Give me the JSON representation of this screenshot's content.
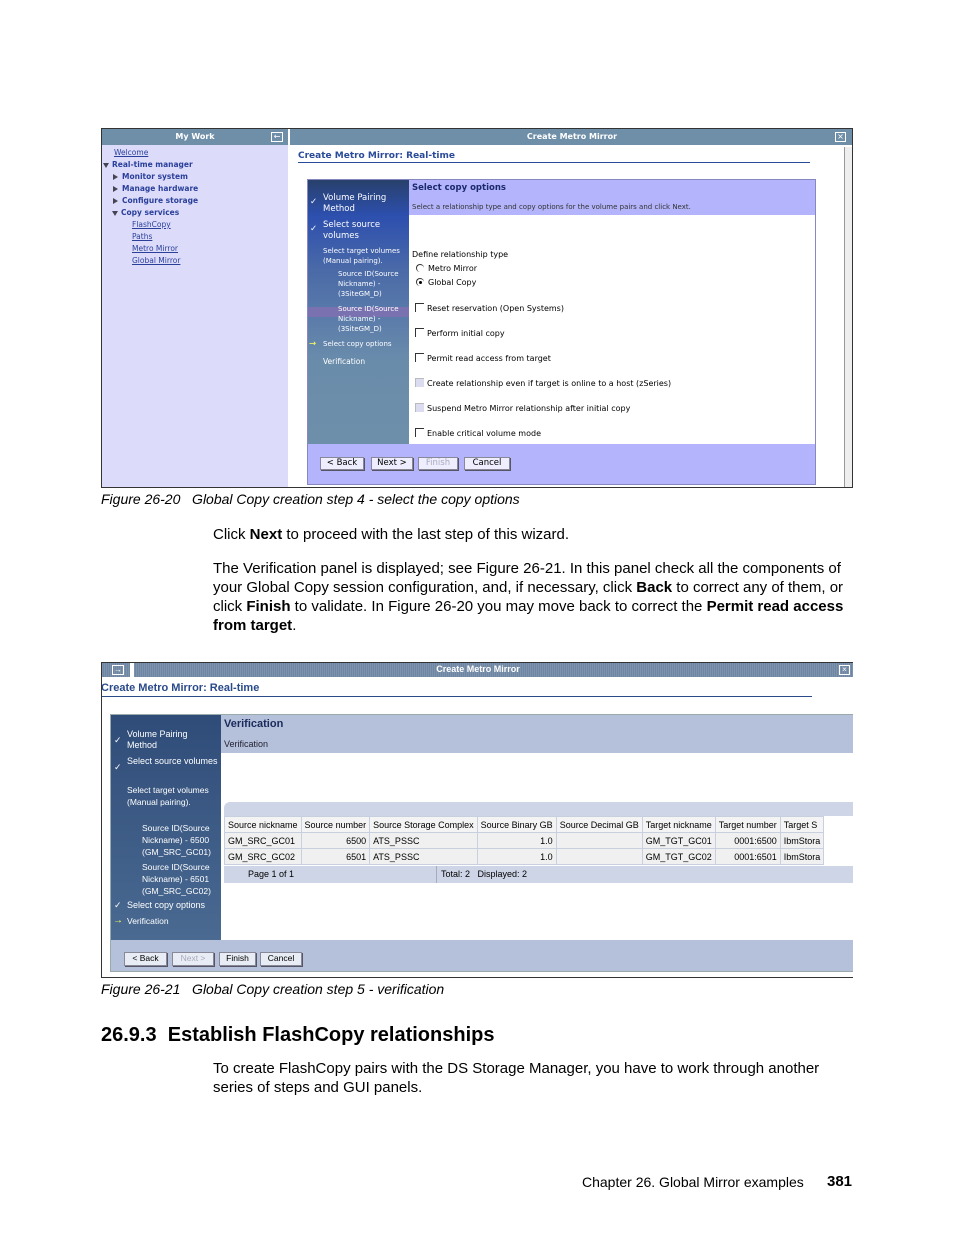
{
  "figure1": {
    "left_pane_title": "My Work",
    "nav": [
      {
        "label": "Welcome",
        "type": "link"
      },
      {
        "label": "Real-time manager",
        "type": "expanded"
      },
      {
        "label": "Monitor system",
        "type": "collapsed"
      },
      {
        "label": "Manage hardware",
        "type": "collapsed"
      },
      {
        "label": "Configure storage",
        "type": "collapsed"
      },
      {
        "label": "Copy services",
        "type": "expanded"
      },
      {
        "label": "FlashCopy",
        "type": "link"
      },
      {
        "label": "Paths",
        "type": "link"
      },
      {
        "label": "Metro Mirror",
        "type": "link"
      },
      {
        "label": "Global Mirror",
        "type": "link"
      }
    ],
    "window_title": "Create Metro Mirror",
    "page_title": "Create Metro Mirror: Real-time",
    "steps": [
      "Volume Pairing Method",
      "Select source volumes",
      "Select target volumes (Manual pairing).",
      "Source ID(Source Nickname) - (3SiteGM_D)",
      "Source ID(Source Nickname) - (3SiteGM_D)",
      "Select copy options",
      "Verification"
    ],
    "section_title": "Select copy options",
    "section_desc": "Select a relationship type and copy options for the volume pairs and click Next.",
    "relationship_label": "Define relationship type",
    "radios": [
      {
        "label": "Metro Mirror",
        "selected": false
      },
      {
        "label": "Global Copy",
        "selected": true
      }
    ],
    "checkboxes": [
      {
        "label": "Reset reservation (Open Systems)",
        "checked": false,
        "enabled": true
      },
      {
        "label": "Perform initial copy",
        "checked": false,
        "enabled": true
      },
      {
        "label": "Permit read access from target",
        "checked": false,
        "enabled": true
      },
      {
        "label": "Create relationship even if target is online to a host (zSeries)",
        "checked": false,
        "enabled": false
      },
      {
        "label": "Suspend Metro Mirror relationship after initial copy",
        "checked": false,
        "enabled": false
      },
      {
        "label": "Enable critical volume mode",
        "checked": false,
        "enabled": true
      }
    ],
    "buttons": {
      "back": "< Back",
      "next": "Next >",
      "finish": "Finish",
      "cancel": "Cancel"
    },
    "caption": "Figure 26-20   Global Copy creation step 4 - select the copy options"
  },
  "text": {
    "p1_a": "Click ",
    "p1_b": "Next",
    "p1_c": " to proceed with the last step of this wizard.",
    "p2_a": "The Verification panel is displayed; see Figure 26-21. In this panel check all the components of your Global Copy session configuration, and, if necessary, click ",
    "p2_b": "Back",
    "p2_c": " to correct any of them, or click ",
    "p2_d": "Finish",
    "p2_e": " to validate. In Figure 26-20 you may move back to correct the ",
    "p2_f": "Permit read access from target",
    "p2_g": "."
  },
  "figure2": {
    "window_title": "Create Metro Mirror",
    "page_title": "Create Metro Mirror: Real-time",
    "steps": [
      "Volume Pairing Method",
      "Select source volumes",
      "Select target volumes (Manual pairing).",
      "Source ID(Source Nickname) - 6500 (GM_SRC_GC01)",
      "Source ID(Source Nickname) - 6501 (GM_SRC_GC02)",
      "Select copy options",
      "Verification"
    ],
    "section_title": "Verification",
    "section_desc": "Verification",
    "columns": [
      "Source nickname",
      "Source number",
      "Source Storage Complex",
      "Source Binary GB",
      "Source Decimal GB",
      "Target nickname",
      "Target number",
      "Target S"
    ],
    "rows": [
      [
        "GM_SRC_GC01",
        "6500",
        "ATS_PSSC",
        "1.0",
        "",
        "GM_TGT_GC01",
        "0001:6500",
        "IbmStora"
      ],
      [
        "GM_SRC_GC02",
        "6501",
        "ATS_PSSC",
        "1.0",
        "",
        "GM_TGT_GC02",
        "0001:6501",
        "IbmStora"
      ]
    ],
    "pager": "Page 1 of 1",
    "totals": "Total: 2   Displayed: 2",
    "buttons": {
      "back": "< Back",
      "next": "Next >",
      "finish": "Finish",
      "cancel": "Cancel"
    },
    "caption": "Figure 26-21   Global Copy creation step 5 - verification"
  },
  "section": {
    "number": "26.9.3",
    "title": "Establish FlashCopy relationships",
    "body": "To create FlashCopy pairs with the DS Storage Manager, you have to work through another series of steps and GUI panels."
  },
  "footer": {
    "chapter": "Chapter 26. Global Mirror examples",
    "page": "381"
  }
}
